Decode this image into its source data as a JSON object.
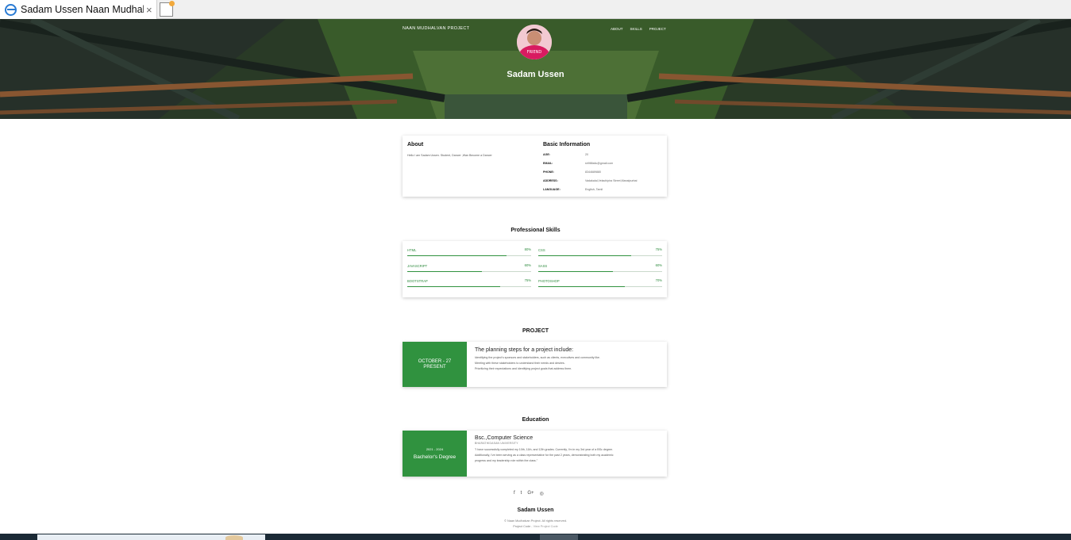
{
  "browser": {
    "tab_title": "Sadam Ussen Naan Mudhal...",
    "close_glyph": "×"
  },
  "header": {
    "brand": "NAAN MUDHALVAN PROJECT",
    "nav": [
      "ABOUT",
      "SKILLS",
      "PROJECT"
    ],
    "name": "Sadam Ussen",
    "avatar_caption": "FRIEND"
  },
  "about": {
    "title": "About",
    "text": "Hello I am Sadam Ussen. Student, Dancer ,Wan Become a Dancer"
  },
  "basic_info": {
    "title": "Basic Information",
    "rows": [
      {
        "label": "AGE:",
        "value": "20"
      },
      {
        "label": "EMAIL:",
        "value": "sh986silu@gmail.com"
      },
      {
        "label": "PHONE:",
        "value": "8344689880"
      },
      {
        "label": "ADDRESS:",
        "value": "Vadakalai,Velachipira Street,Manalpurbai"
      },
      {
        "label": "LANGUAGE:",
        "value": "English, Tamil"
      }
    ]
  },
  "skills": {
    "title": "Professional Skills",
    "items": [
      {
        "name": "HTML",
        "percent_label": "80%",
        "percent": 80
      },
      {
        "name": "CSS",
        "percent_label": "75%",
        "percent": 75
      },
      {
        "name": "JAVASCRIPT",
        "percent_label": "60%",
        "percent": 60
      },
      {
        "name": "SASS",
        "percent_label": "60%",
        "percent": 60
      },
      {
        "name": "BOOTSTRAP",
        "percent_label": "75%",
        "percent": 75
      },
      {
        "name": "PHOTOSHOP",
        "percent_label": "70%",
        "percent": 70
      }
    ]
  },
  "project": {
    "title": "PROJECT",
    "date_line1": "OCTOBER - 27",
    "date_line2": "PRESENT",
    "heading": "The planning steps for a project include:",
    "lines": [
      "Identifying the project's sponsors and stakeholders, such as clients, executives and community like.",
      "Meeting with these stakeholders to understand their needs and desires.",
      "Prioritizing their expectations and identifying project goals that address them."
    ]
  },
  "education": {
    "title": "Education",
    "years": "2021 - 2024",
    "degree": "Bachelor's Degree",
    "heading": "Bsc.,Computer Science",
    "institution": "BHARATHIDASAN UNIVERSITY",
    "lines": [
      "\"I have successfully completed my 10th, 11th, and 12th grades. Currently, I'm in my 3rd year of a BSc degree.",
      "Additionally, I've been serving as a class representative for the past 2 years, demonstrating both my academic",
      "progress and my leadership role within the class.\""
    ]
  },
  "footer": {
    "socials": [
      "f",
      "t",
      "G+",
      "◎"
    ],
    "name": "Sadam Ussen",
    "copyright": "© Naan Mudhalvan Project. All rights reserved.",
    "project_code_label": "Project Code - ",
    "project_code_link": "View Project Code"
  },
  "colors": {
    "accent": "#30923f",
    "skill_text": "#2e8b3e"
  }
}
